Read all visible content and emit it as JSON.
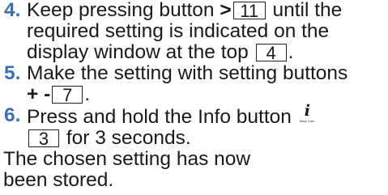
{
  "colors": {
    "step_number": "#3a6fb4",
    "text": "#1a1a1a",
    "background": "#ffffff"
  },
  "steps": [
    {
      "number": "4.",
      "line1_a": "Keep pressing button",
      "button_symbol": ">",
      "ref_a": "11",
      "line1_b": "until the",
      "line2": "required setting is indicated on the",
      "line3_a": "display window at the top",
      "ref_b": "4",
      "line3_end": "."
    },
    {
      "number": "5.",
      "line1": "Make the setting with setting buttons",
      "button_symbols": "+ -",
      "ref": "7",
      "line2_end": "."
    },
    {
      "number": "6.",
      "line1": "Press and hold the Info button",
      "info_icon": "info-i-icon",
      "info_icon_caption": "Setup 3 sec.",
      "ref": "3",
      "line2": "for 3 seconds."
    }
  ],
  "closing": "The chosen setting has now been stored."
}
